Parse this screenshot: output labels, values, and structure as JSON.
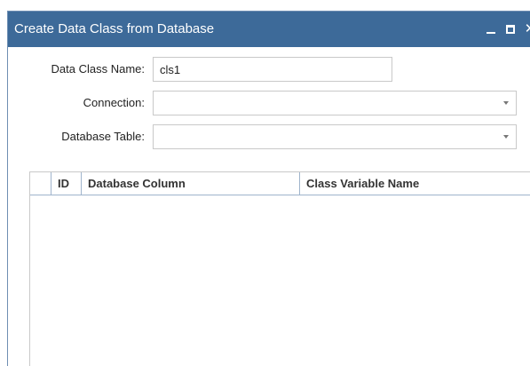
{
  "window": {
    "title": "Create Data Class from Database",
    "controls": {
      "minimize": "minimize-icon",
      "maximize": "maximize-icon",
      "close": "close-icon"
    },
    "colors": {
      "titlebar": "#3d6a99",
      "border": "#6f8fb3"
    }
  },
  "form": {
    "class_name": {
      "label": "Data Class Name:",
      "value": "cls1"
    },
    "connection": {
      "label": "Connection:",
      "value": ""
    },
    "table": {
      "label": "Database Table:",
      "value": ""
    }
  },
  "grid": {
    "columns": [
      "ID",
      "Database Column",
      "Class Variable Name"
    ],
    "rows": []
  }
}
